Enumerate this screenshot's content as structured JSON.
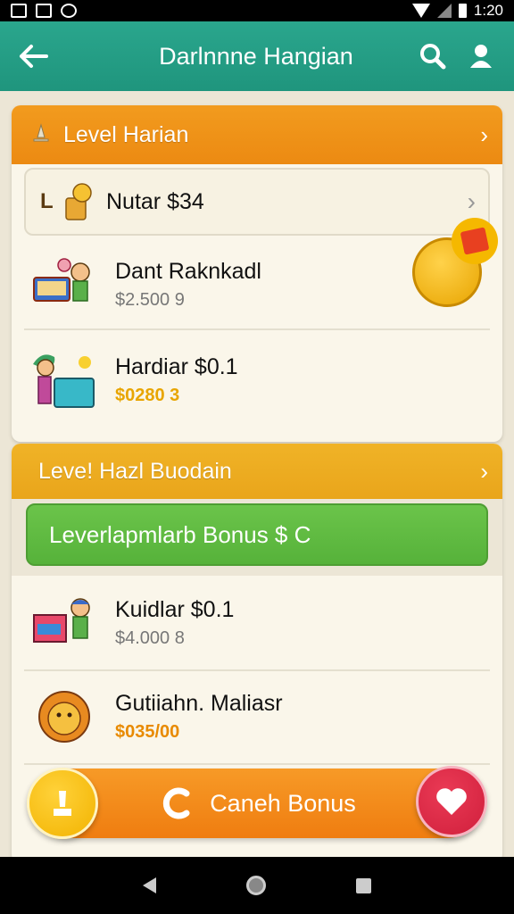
{
  "status_bar": {
    "time": "1:20"
  },
  "app_bar": {
    "title": "Darlnnne Hangian",
    "back_icon": "arrow-left-icon",
    "search_icon": "search-icon",
    "profile_icon": "user-icon"
  },
  "section1": {
    "title": "Level Harian",
    "items": [
      {
        "prefix": "L",
        "name": "Nutar $34",
        "amount": "",
        "icon": "coin-bucket-icon"
      },
      {
        "name": "Dant Raknkadl",
        "amount": "$2.500 9",
        "icon": "kid-computer-icon"
      },
      {
        "name": "Hardiar $0.1",
        "amount": "$0280 3",
        "icon": "kid-box-icon"
      }
    ]
  },
  "section2": {
    "title": "Leve! Hazl Buodain",
    "banner": "Leverlapmlarb Bonus $ C",
    "items": [
      {
        "name": "Kuidlar $0.1",
        "amount": "$4.000 8",
        "icon": "gift-kid-icon"
      },
      {
        "name": "Gutiiahn. Maliasr",
        "amount": "$035/00",
        "icon": "lion-mascot-icon"
      }
    ]
  },
  "cta": {
    "label": "Caneh Bonus",
    "icon": "c-coin-icon"
  },
  "colors": {
    "primary": "#1f957d",
    "orange": "#ef7d10",
    "green": "#56b23a",
    "gold": "#e8a500"
  }
}
